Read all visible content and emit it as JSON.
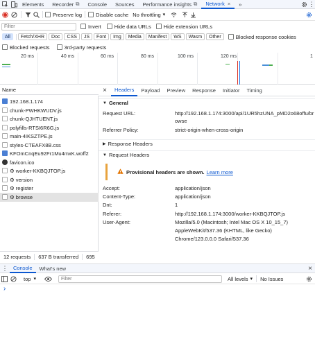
{
  "top_tabs": [
    "Elements",
    "Recorder",
    "Console",
    "Sources",
    "Performance insights",
    "Network"
  ],
  "top_icons": {
    "more": "»",
    "settings": "gear-icon",
    "more_menu": "⋮"
  },
  "toolbar": {
    "preserve_log": "Preserve log",
    "disable_cache": "Disable cache",
    "throttling": "No throttling"
  },
  "filter": {
    "placeholder": "Filter",
    "invert": "Invert",
    "hide_data_urls": "Hide data URLs",
    "hide_extension_urls": "Hide extension URLs"
  },
  "type_filters": [
    "All",
    "Fetch/XHR",
    "Doc",
    "CSS",
    "JS",
    "Font",
    "Img",
    "Media",
    "Manifest",
    "WS",
    "Wasm",
    "Other"
  ],
  "blocked_response_cookies": "Blocked response cookies",
  "blocked_requests": "Blocked requests",
  "third_party": "3rd-party requests",
  "overview_ticks": [
    "20 ms",
    "40 ms",
    "60 ms",
    "80 ms",
    "100 ms",
    "120 ms",
    "1"
  ],
  "name_header": "Name",
  "requests": [
    {
      "name": "192.168.1.174",
      "type": "doc"
    },
    {
      "name": "chunk-PWHKWUDV.js",
      "type": "js"
    },
    {
      "name": "chunk-QJHTUENT.js",
      "type": "js"
    },
    {
      "name": "polyfills-RTSI6R6G.js",
      "type": "js"
    },
    {
      "name": "main-4IKSZTPE.js",
      "type": "js"
    },
    {
      "name": "styles-CTEAFX8B.css",
      "type": "css"
    },
    {
      "name": "KFOmCnqEu92Fr1Mu4mxK.woff2",
      "type": "font"
    },
    {
      "name": "favicon.ico",
      "type": "img"
    },
    {
      "name": "⚙ worker-KKBQJTOP.js",
      "type": "js"
    },
    {
      "name": "⚙ version",
      "type": "other"
    },
    {
      "name": "⚙ register",
      "type": "other"
    },
    {
      "name": "⚙ browse",
      "type": "other"
    }
  ],
  "status": {
    "requests": "12 requests",
    "transferred": "637 B transferred",
    "extra": "695"
  },
  "detail_tabs": [
    "Headers",
    "Payload",
    "Preview",
    "Response",
    "Initiator",
    "Timing"
  ],
  "general": {
    "title": "General",
    "request_url_key": "Request URL:",
    "request_url_val1": "http://192.168.1.174:3000/api/1UR5hzUNA_pMD2o68offu/br",
    "request_url_val2": "owse",
    "referrer_key": "Referrer Policy:",
    "referrer_val": "strict-origin-when-cross-origin"
  },
  "response_headers_title": "Response Headers",
  "request_headers": {
    "title": "Request Headers",
    "warning": "Provisional headers are shown.",
    "learn_more": "Learn more",
    "rows": [
      {
        "k": "Accept:",
        "v": "application/json"
      },
      {
        "k": "Content-Type:",
        "v": "application/json"
      },
      {
        "k": "Dnt:",
        "v": "1"
      },
      {
        "k": "Referer:",
        "v": "http://192.168.1.174:3000/worker-KKBQJTOP.js"
      },
      {
        "k": "User-Agent:",
        "v": "Mozilla/5.0 (Macintosh; Intel Mac OS X 10_15_7)"
      }
    ],
    "ua_line2": "AppleWebKit/537.36 (KHTML, like Gecko)",
    "ua_line3": "Chrome/123.0.0.0 Safari/537.36"
  },
  "drawer": {
    "tabs": [
      "Console",
      "What's new"
    ]
  },
  "console": {
    "context": "top",
    "filter_placeholder": "Filter",
    "levels": "All levels",
    "issues": "No Issues",
    "prompt": "›"
  },
  "colors": {
    "accent": "#0b57d0",
    "selected": "#e3e3e3",
    "record": "#d93025"
  }
}
